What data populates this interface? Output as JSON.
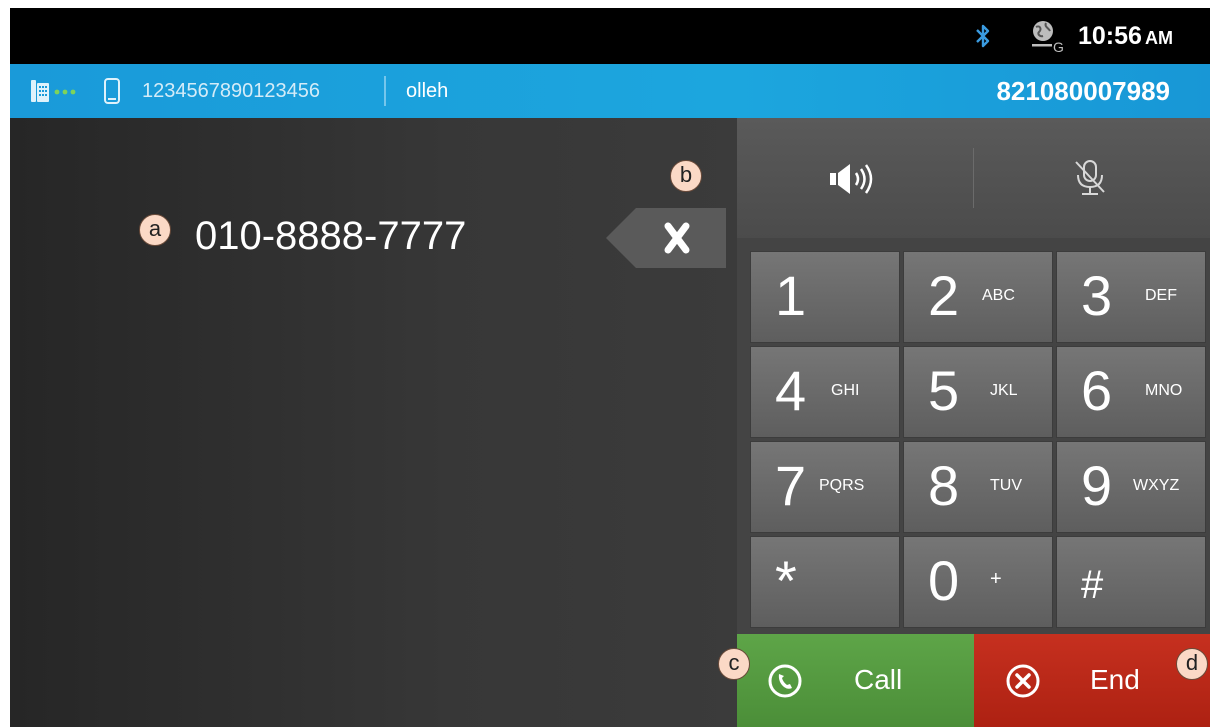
{
  "status_bar": {
    "time": "10:56",
    "ampm": "AM",
    "icons": [
      "bluetooth-icon",
      "network-globe-icon"
    ]
  },
  "carrier_bar": {
    "imei": "1234567890123456",
    "carrier": "olleh",
    "own_number": "821080007989",
    "icons": [
      "desk-phone-icon",
      "link-dots-icon",
      "mobile-phone-icon"
    ]
  },
  "dialer": {
    "number": "010-8888-7777",
    "backspace_label": "x",
    "controls": [
      "speaker-icon",
      "mute-mic-icon"
    ]
  },
  "keypad": {
    "keys": [
      {
        "digit": "1",
        "letters": ""
      },
      {
        "digit": "2",
        "letters": "ABC"
      },
      {
        "digit": "3",
        "letters": "DEF"
      },
      {
        "digit": "4",
        "letters": "GHI"
      },
      {
        "digit": "5",
        "letters": "JKL"
      },
      {
        "digit": "6",
        "letters": "MNO"
      },
      {
        "digit": "7",
        "letters": "PQRS"
      },
      {
        "digit": "8",
        "letters": "TUV"
      },
      {
        "digit": "9",
        "letters": "WXYZ"
      },
      {
        "digit": "*",
        "letters": ""
      },
      {
        "digit": "0",
        "letters": "+"
      },
      {
        "digit": "#",
        "letters": ""
      }
    ]
  },
  "actions": {
    "call_label": "Call",
    "end_label": "End"
  },
  "callouts": {
    "a": "a",
    "b": "b",
    "c": "c",
    "d": "d"
  },
  "colors": {
    "carrier_bar": "#1ca6de",
    "call": "#56a043",
    "end": "#c02a1a",
    "callout_fill": "#fbd9c6"
  }
}
